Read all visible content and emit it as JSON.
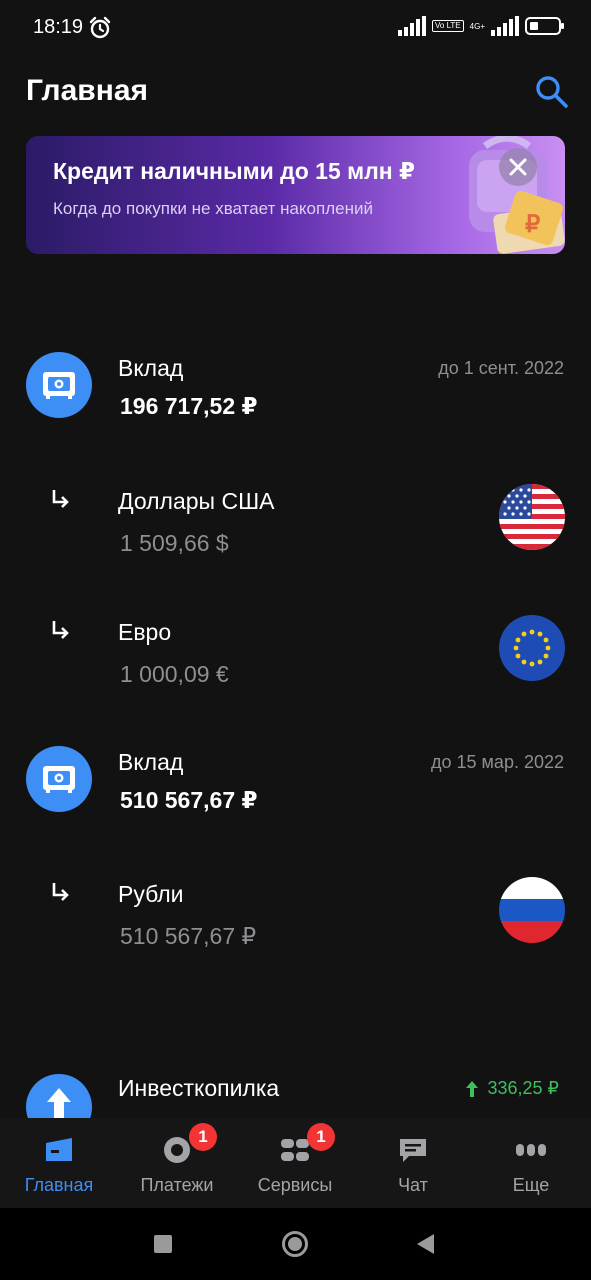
{
  "status_bar": {
    "time": "18:19",
    "volte": "Vo LTE",
    "network": "4G+"
  },
  "header": {
    "title": "Главная"
  },
  "promo": {
    "title": "Кредит наличными до 15 млн ₽",
    "subtitle": "Когда до покупки не хватает накоплений"
  },
  "accounts": [
    {
      "name": "Вклад",
      "amount": "196 717,52 ₽",
      "date": "до 1 сент. 2022"
    },
    {
      "name": "Доллары США",
      "amount": "1 509,66 $"
    },
    {
      "name": "Евро",
      "amount": "1 000,09 €"
    },
    {
      "name": "Вклад",
      "amount": "510 567,67 ₽",
      "date": "до 15 мар. 2022"
    },
    {
      "name": "Рубли",
      "amount": "510 567,67 ₽"
    },
    {
      "name": "Инвесткопилка",
      "growth": "336,25 ₽"
    }
  ],
  "tabs": [
    {
      "label": "Главная",
      "active": true
    },
    {
      "label": "Платежи",
      "badge": "1"
    },
    {
      "label": "Сервисы",
      "badge": "1"
    },
    {
      "label": "Чат"
    },
    {
      "label": "Еще"
    }
  ],
  "colors": {
    "accent": "#3d8ef5",
    "background": "#121212",
    "positive": "#3fbe5e",
    "badge": "#f23434"
  }
}
